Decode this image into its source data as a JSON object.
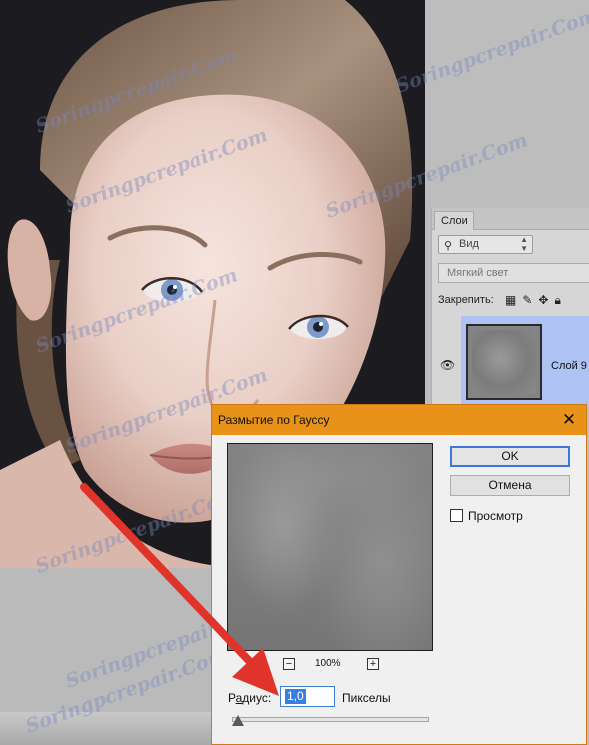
{
  "watermark": {
    "text": "Soringpcrepair.Com",
    "color": "#7887be"
  },
  "layers_panel": {
    "tab_label": "Слои",
    "filter_label": "Вид",
    "blend_mode": "Мягкий свет",
    "lock_label": "Закрепить:",
    "lock_icons": [
      "checkerboard-lock-icon",
      "brush-lock-icon",
      "move-lock-icon",
      "padlock-icon"
    ],
    "layer_name": "Слой 9",
    "selection_color": "#aec2f4"
  },
  "dialog": {
    "title": "Размытие по Гауссу",
    "close_glyph": "✕",
    "ok_label": "OK",
    "cancel_label": "Отмена",
    "preview_label": "Просмотр",
    "preview_checked": false,
    "zoom_level": "100%",
    "zoom_out_glyph": "−",
    "zoom_in_glyph": "+",
    "radius_label_prefix": "Р",
    "radius_label_underlined": "а",
    "radius_label_rest": "диус:",
    "radius_value": "1,0",
    "units_label": "Пикселы",
    "slider_value_fraction": 0.03,
    "titlebar_color": "#e8921a"
  },
  "annotation": {
    "arrow_color": "#e0332a"
  }
}
